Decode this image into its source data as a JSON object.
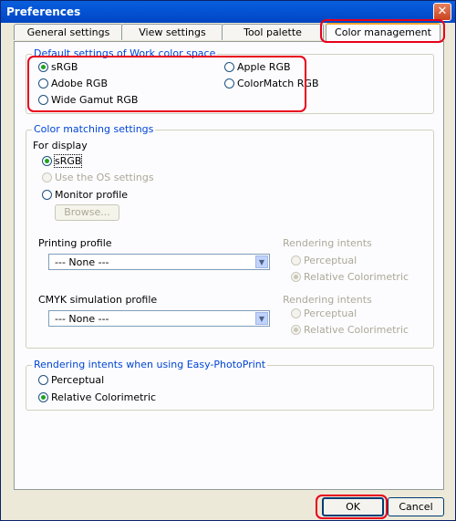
{
  "window": {
    "title": "Preferences",
    "close_glyph": "✕"
  },
  "tabs": [
    {
      "label": "General settings",
      "active": false
    },
    {
      "label": "View settings",
      "active": false
    },
    {
      "label": "Tool palette",
      "active": false
    },
    {
      "label": "Color management",
      "active": true
    }
  ],
  "work_color_space": {
    "label": "Default settings of Work color space",
    "options": [
      {
        "label": "sRGB",
        "selected": true
      },
      {
        "label": "Apple RGB",
        "selected": false
      },
      {
        "label": "Adobe RGB",
        "selected": false
      },
      {
        "label": "ColorMatch RGB",
        "selected": false
      },
      {
        "label": "Wide Gamut RGB",
        "selected": false
      }
    ]
  },
  "color_matching": {
    "label": "Color matching settings",
    "for_display_label": "For display",
    "display_options": [
      {
        "label": "sRGB",
        "selected": true,
        "enabled": true
      },
      {
        "label": "Use the OS settings",
        "selected": false,
        "enabled": false
      },
      {
        "label": "Monitor profile",
        "selected": false,
        "enabled": true
      }
    ],
    "browse_label": "Browse...",
    "printing_profile": {
      "label": "Printing profile",
      "value": "--- None ---"
    },
    "printing_intents": {
      "label": "Rendering intents",
      "options": [
        {
          "label": "Perceptual",
          "selected": false
        },
        {
          "label": "Relative Colorimetric",
          "selected": true
        }
      ]
    },
    "cmyk_profile": {
      "label": "CMYK simulation profile",
      "value": "--- None ---"
    },
    "cmyk_intents": {
      "label": "Rendering intents",
      "options": [
        {
          "label": "Perceptual",
          "selected": false
        },
        {
          "label": "Relative Colorimetric",
          "selected": true
        }
      ]
    }
  },
  "easy_photoprint": {
    "label": "Rendering intents when using Easy-PhotoPrint",
    "options": [
      {
        "label": "Perceptual",
        "selected": false
      },
      {
        "label": "Relative Colorimetric",
        "selected": true
      }
    ]
  },
  "buttons": {
    "ok": "OK",
    "cancel": "Cancel"
  },
  "colors": {
    "accent": "#0046d5",
    "highlight": "#e8001c",
    "title_bar": "#0353d4"
  },
  "icons": {
    "close": "close-icon",
    "dropdown": "chevron-down-icon"
  }
}
